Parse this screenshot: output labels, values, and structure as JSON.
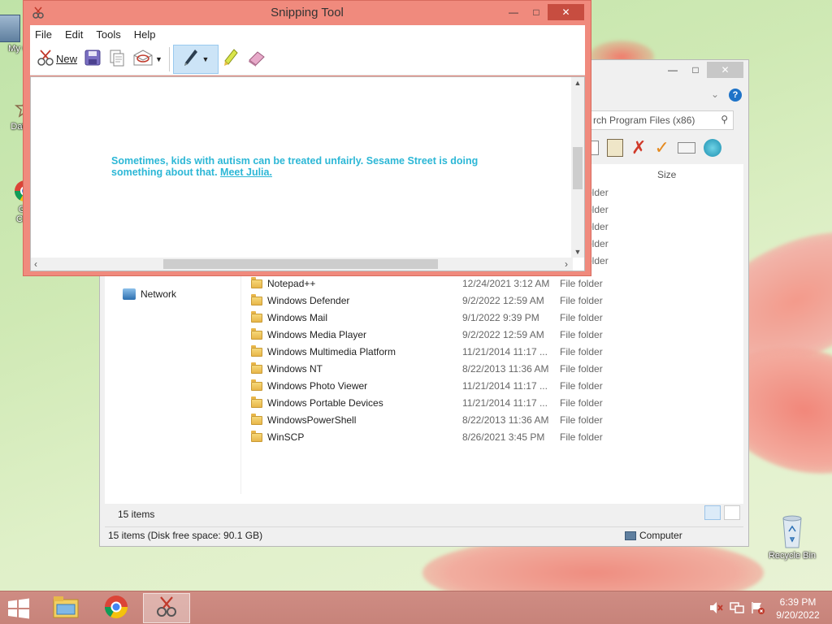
{
  "desktop": {
    "icons": [
      {
        "label": "My C",
        "icon": "computer-icon"
      },
      {
        "label": "Data",
        "icon": "shortcut-icon"
      },
      {
        "label": "G\nCh",
        "icon": "chrome-shortcut-icon"
      },
      {
        "label": "Recycle Bin",
        "icon": "recycle-bin-icon"
      }
    ]
  },
  "snipping_tool": {
    "title": "Snipping Tool",
    "menu": [
      "File",
      "Edit",
      "Tools",
      "Help"
    ],
    "toolbar": {
      "new_label": "New",
      "icons": [
        "new-snip-icon",
        "save-icon",
        "copy-icon",
        "send-snip-icon",
        "dropdown-arrow-icon",
        "pen-icon",
        "pen-dropdown-icon",
        "highlighter-icon",
        "eraser-icon"
      ]
    },
    "capture": {
      "text": "Sometimes, kids with autism can be treated unfairly. Sesame Street is doing something about that.",
      "link_text": "Meet Julia.",
      "text_color": "#2cb7d6"
    }
  },
  "explorer": {
    "search_placeholder": "rch Program Files (x86)",
    "column_size": "Size",
    "partial_types": [
      "older",
      "older",
      "older",
      "older",
      "older"
    ],
    "nav_network": "Network",
    "files": [
      {
        "name": "Notepad++",
        "date": "12/24/2021 3:12 AM",
        "type": "File folder"
      },
      {
        "name": "Windows Defender",
        "date": "9/2/2022 12:59 AM",
        "type": "File folder"
      },
      {
        "name": "Windows Mail",
        "date": "9/1/2022 9:39 PM",
        "type": "File folder"
      },
      {
        "name": "Windows Media Player",
        "date": "9/2/2022 12:59 AM",
        "type": "File folder"
      },
      {
        "name": "Windows Multimedia Platform",
        "date": "11/21/2014 11:17 ...",
        "type": "File folder"
      },
      {
        "name": "Windows NT",
        "date": "8/22/2013 11:36 AM",
        "type": "File folder"
      },
      {
        "name": "Windows Photo Viewer",
        "date": "11/21/2014 11:17 ...",
        "type": "File folder"
      },
      {
        "name": "Windows Portable Devices",
        "date": "11/21/2014 11:17 ...",
        "type": "File folder"
      },
      {
        "name": "WindowsPowerShell",
        "date": "8/22/2013 11:36 AM",
        "type": "File folder"
      },
      {
        "name": "WinSCP",
        "date": "8/26/2021 3:45 PM",
        "type": "File folder"
      }
    ],
    "item_count": "15 items",
    "status_left": "15 items (Disk free space: 90.1 GB)",
    "status_right": "Computer"
  },
  "taskbar": {
    "apps": [
      "file-explorer-icon",
      "chrome-icon",
      "snipping-tool-icon"
    ],
    "active_app": "snipping-tool-icon",
    "tray_icons": [
      "volume-muted-icon",
      "network-icon",
      "action-center-icon"
    ],
    "time": "6:39 PM",
    "date": "9/20/2022"
  }
}
